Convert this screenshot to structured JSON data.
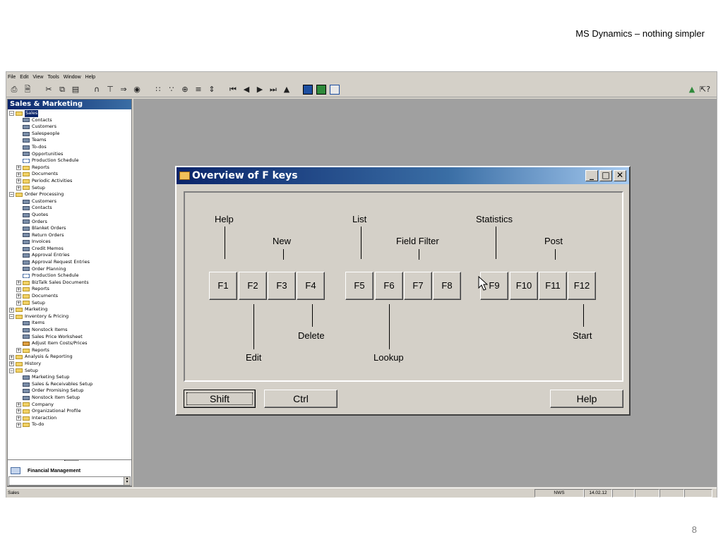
{
  "slide": {
    "title": "MS Dynamics – nothing simpler",
    "page_number": "8"
  },
  "menu": [
    "File",
    "Edit",
    "View",
    "Tools",
    "Window",
    "Help"
  ],
  "nav": {
    "header": "Sales & Marketing",
    "tree": [
      {
        "label": "Sales",
        "depth": 0,
        "exp": "minus",
        "icon": "folder",
        "selected": true
      },
      {
        "label": "Contacts",
        "depth": 1,
        "icon": "form"
      },
      {
        "label": "Customers",
        "depth": 1,
        "icon": "form"
      },
      {
        "label": "Salespeople",
        "depth": 1,
        "icon": "form"
      },
      {
        "label": "Teams",
        "depth": 1,
        "icon": "form"
      },
      {
        "label": "To-dos",
        "depth": 1,
        "icon": "form"
      },
      {
        "label": "Opportunities",
        "depth": 1,
        "icon": "form"
      },
      {
        "label": "Production Schedule",
        "depth": 1,
        "icon": "sched"
      },
      {
        "label": "Reports",
        "depth": 1,
        "exp": "plus",
        "icon": "folder"
      },
      {
        "label": "Documents",
        "depth": 1,
        "exp": "plus",
        "icon": "folder"
      },
      {
        "label": "Periodic Activities",
        "depth": 1,
        "exp": "plus",
        "icon": "folder"
      },
      {
        "label": "Setup",
        "depth": 1,
        "exp": "plus",
        "icon": "folder"
      },
      {
        "label": "Order Processing",
        "depth": 0,
        "exp": "minus",
        "icon": "folder"
      },
      {
        "label": "Customers",
        "depth": 1,
        "icon": "form"
      },
      {
        "label": "Contacts",
        "depth": 1,
        "icon": "form"
      },
      {
        "label": "Quotes",
        "depth": 1,
        "icon": "form"
      },
      {
        "label": "Orders",
        "depth": 1,
        "icon": "form"
      },
      {
        "label": "Blanket Orders",
        "depth": 1,
        "icon": "form"
      },
      {
        "label": "Return Orders",
        "depth": 1,
        "icon": "form"
      },
      {
        "label": "Invoices",
        "depth": 1,
        "icon": "form"
      },
      {
        "label": "Credit Memos",
        "depth": 1,
        "icon": "form"
      },
      {
        "label": "Approval Entries",
        "depth": 1,
        "icon": "form"
      },
      {
        "label": "Approval Request Entries",
        "depth": 1,
        "icon": "form"
      },
      {
        "label": "Order Planning",
        "depth": 1,
        "icon": "form"
      },
      {
        "label": "Production Schedule",
        "depth": 1,
        "icon": "sched"
      },
      {
        "label": "BizTalk Sales Documents",
        "depth": 1,
        "exp": "plus",
        "icon": "folder"
      },
      {
        "label": "Reports",
        "depth": 1,
        "exp": "plus",
        "icon": "folder"
      },
      {
        "label": "Documents",
        "depth": 1,
        "exp": "plus",
        "icon": "folder"
      },
      {
        "label": "Setup",
        "depth": 1,
        "exp": "plus",
        "icon": "folder"
      },
      {
        "label": "Marketing",
        "depth": 0,
        "exp": "plus",
        "icon": "folder"
      },
      {
        "label": "Inventory & Pricing",
        "depth": 0,
        "exp": "minus",
        "icon": "folder"
      },
      {
        "label": "Items",
        "depth": 1,
        "icon": "form"
      },
      {
        "label": "Nonstock Items",
        "depth": 1,
        "icon": "form"
      },
      {
        "label": "Sales Price Worksheet",
        "depth": 1,
        "icon": "form"
      },
      {
        "label": "Adjust Item Costs/Prices",
        "depth": 1,
        "icon": "item"
      },
      {
        "label": "Reports",
        "depth": 1,
        "exp": "plus",
        "icon": "folder"
      },
      {
        "label": "Analysis & Reporting",
        "depth": 0,
        "exp": "plus",
        "icon": "folder"
      },
      {
        "label": "History",
        "depth": 0,
        "exp": "plus",
        "icon": "folder"
      },
      {
        "label": "Setup",
        "depth": 0,
        "exp": "minus",
        "icon": "folder"
      },
      {
        "label": "Marketing Setup",
        "depth": 1,
        "icon": "form"
      },
      {
        "label": "Sales & Receivables Setup",
        "depth": 1,
        "icon": "form"
      },
      {
        "label": "Order Promising Setup",
        "depth": 1,
        "icon": "form"
      },
      {
        "label": "Nonstock Item Setup",
        "depth": 1,
        "icon": "form"
      },
      {
        "label": "Company",
        "depth": 1,
        "exp": "plus",
        "icon": "folder"
      },
      {
        "label": "Organizational Profile",
        "depth": 1,
        "exp": "plus",
        "icon": "folder"
      },
      {
        "label": "Interaction",
        "depth": 1,
        "exp": "plus",
        "icon": "folder"
      },
      {
        "label": "To-do",
        "depth": 1,
        "exp": "plus",
        "icon": "folder"
      }
    ],
    "bottom_item": "Financial Management"
  },
  "status": {
    "left": "Sales",
    "code": "NWS",
    "date": "14.02.12"
  },
  "dialog": {
    "title": "Overview of F keys",
    "keys": [
      "F1",
      "F2",
      "F3",
      "F4",
      "F5",
      "F6",
      "F7",
      "F8",
      "F9",
      "F10",
      "F11",
      "F12"
    ],
    "labels_top": {
      "help": "Help",
      "new": "New",
      "list": "List",
      "field_filter": "Field Filter",
      "statistics": "Statistics",
      "post": "Post"
    },
    "labels_bottom": {
      "edit": "Edit",
      "delete": "Delete",
      "lookup": "Lookup",
      "start": "Start"
    },
    "buttons": {
      "shift": "Shift",
      "ctrl": "Ctrl",
      "help": "Help"
    }
  }
}
